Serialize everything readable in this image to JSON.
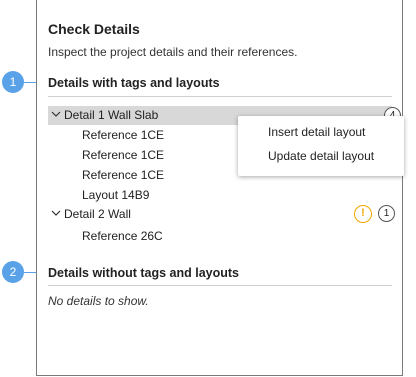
{
  "panel": {
    "title": "Check Details",
    "subtitle": "Inspect the project details and their references."
  },
  "callouts": [
    "1",
    "2"
  ],
  "sections": {
    "with": {
      "header": "Details with tags and layouts",
      "rows": [
        {
          "label": "Detail 1 Wall Slab",
          "count": "4"
        },
        {
          "label": "Reference 1CE"
        },
        {
          "label": "Reference 1CE"
        },
        {
          "label": "Reference 1CE"
        },
        {
          "label": "Layout 14B9"
        },
        {
          "label": "Detail 2 Wall",
          "warning": "!",
          "count": "1"
        },
        {
          "label": "Reference 26C"
        }
      ]
    },
    "without": {
      "header": "Details without tags and layouts",
      "empty": "No details to show."
    }
  },
  "context_menu": {
    "items": [
      "Insert detail layout",
      "Update detail layout"
    ]
  },
  "colors": {
    "callout": "#5aa2e8",
    "warning": "#f0a800",
    "selected_row": "#d8d8d8"
  }
}
